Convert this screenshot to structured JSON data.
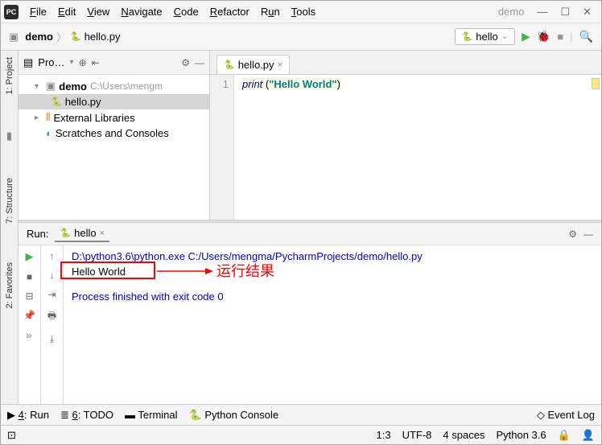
{
  "title_project": "demo",
  "menu": {
    "file": "File",
    "edit": "Edit",
    "view": "View",
    "navigate": "Navigate",
    "code": "Code",
    "refactor": "Refactor",
    "run": "Run",
    "tools": "Tools"
  },
  "breadcrumb": {
    "project": "demo",
    "file": "hello.py"
  },
  "run_config": {
    "selected": "hello"
  },
  "left_tabs": {
    "project": "1: Project",
    "structure": "7: Structure",
    "favorites": "2: Favorites"
  },
  "project_panel": {
    "title": "Pro…",
    "tree": {
      "root": {
        "name": "demo",
        "path": "C:\\Users\\mengm"
      },
      "file": "hello.py",
      "ext_libs": "External Libraries",
      "scratches": "Scratches and Consoles"
    }
  },
  "editor": {
    "tab": "hello.py",
    "line_number": "1",
    "code_print": "print",
    "code_open": " (",
    "code_str": "\"Hello World\"",
    "code_close": ")"
  },
  "run_panel": {
    "title": "Run:",
    "tab": "hello",
    "cmd": "D:\\python3.6\\python.exe C:/Users/mengma/PycharmProjects/demo/hello.py",
    "output": "Hello World",
    "exit": "Process finished with exit code 0"
  },
  "annotation": {
    "text": "运行结果"
  },
  "bottom": {
    "run": "4: Run",
    "todo": "6: TODO",
    "terminal": "Terminal",
    "python_console": "Python Console",
    "event_log": "Event Log"
  },
  "status": {
    "pos": "1:3",
    "encoding": "UTF-8",
    "indent": "4 spaces",
    "interpreter": "Python 3.6"
  }
}
